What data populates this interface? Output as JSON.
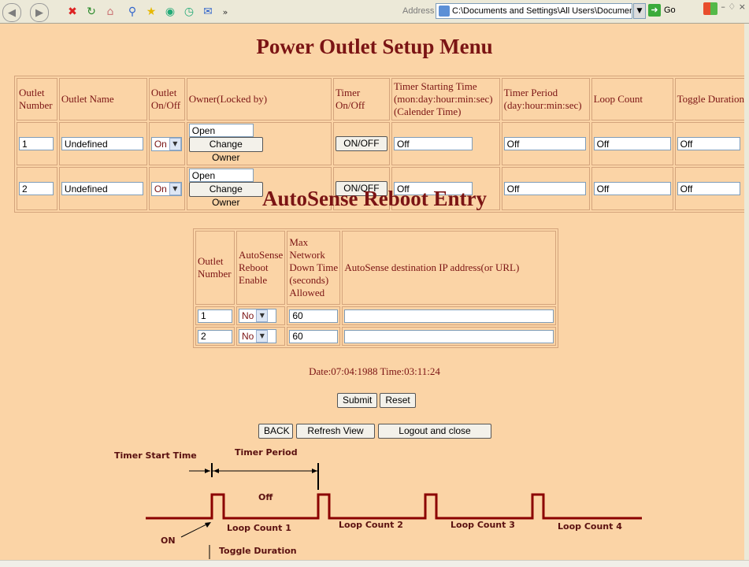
{
  "browser": {
    "address_label": "Address",
    "address_value": "C:\\Documents and Settings\\All Users\\Documents\\pwrPortCfg.htm",
    "go_label": "Go",
    "toolbar_chevron": "»",
    "window_controls": "– ♢ ×"
  },
  "page": {
    "title": "Power Outlet Setup Menu",
    "autosense_title": "AutoSense Reboot Entry",
    "datetime": "Date:07:04:1988 Time:03:11:24"
  },
  "outlet_table": {
    "headers": {
      "number": "Outlet Number",
      "name": "Outlet Name",
      "onoff": "Outlet On/Off",
      "owner": "Owner(Locked by)",
      "timer": "Timer On/Off",
      "start": "Timer Starting Time (mon:day:hour:min:sec) (Calender Time)",
      "period": "Timer Period (day:hour:min:sec)",
      "loop": "Loop Count",
      "toggle": "Toggle Duration"
    },
    "rows": [
      {
        "number": "1",
        "name": "Undefined",
        "onoff": "On",
        "owner": "Open",
        "change_owner": "Change Owner",
        "timer_btn": "ON/OFF",
        "start": "Off",
        "period": "Off",
        "loop": "Off",
        "toggle": "Off"
      },
      {
        "number": "2",
        "name": "Undefined",
        "onoff": "On",
        "owner": "Open",
        "change_owner": "Change Owner",
        "timer_btn": "ON/OFF",
        "start": "Off",
        "period": "Off",
        "loop": "Off",
        "toggle": "Off"
      }
    ]
  },
  "autosense_table": {
    "headers": {
      "number": "Outlet Number",
      "enable": "AutoSense Reboot Enable",
      "downtime": "Max Network Down Time (seconds) Allowed",
      "dest": "AutoSense destination IP address(or URL)"
    },
    "rows": [
      {
        "number": "1",
        "enable": "No",
        "downtime": "60",
        "dest": ""
      },
      {
        "number": "2",
        "enable": "No",
        "downtime": "60",
        "dest": ""
      }
    ]
  },
  "buttons": {
    "submit": "Submit",
    "reset": "Reset",
    "back": "BACK",
    "refresh": "Refresh View",
    "logout": "Logout and close"
  },
  "diagram": {
    "timer_start": "Timer Start Time",
    "timer_period": "Timer Period",
    "off": "Off",
    "on": "ON",
    "loop1": "Loop Count  1",
    "loop2": "Loop Count  2",
    "loop3": "Loop Count 3",
    "loop4": "Loop Count 4",
    "toggle": "Toggle Duration"
  },
  "colors": {
    "background": "#fbd4a6",
    "heading": "#7b1414"
  }
}
